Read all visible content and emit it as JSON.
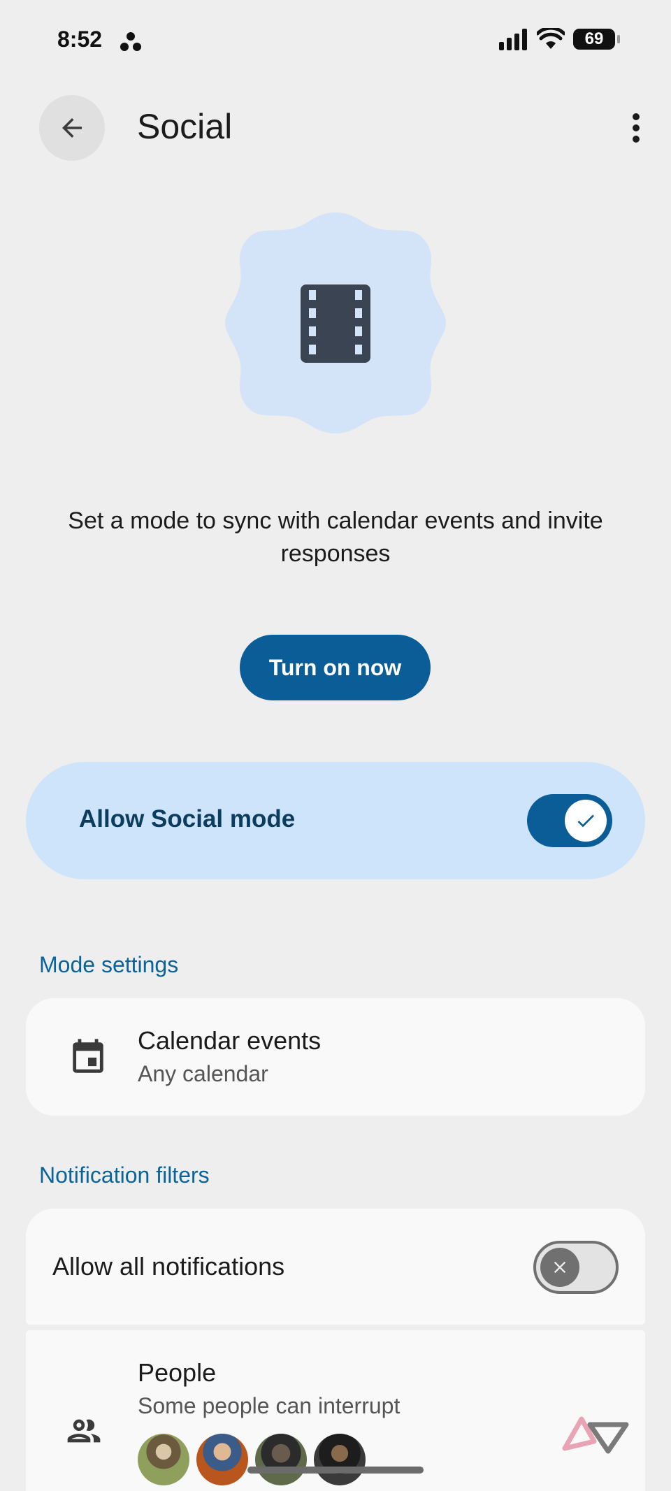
{
  "status_bar": {
    "time": "8:52",
    "battery": "69"
  },
  "header": {
    "title": "Social"
  },
  "hero": {
    "description": "Set a mode to sync with calendar events and invite responses"
  },
  "turn_on_button": {
    "label": "Turn on now"
  },
  "allow_mode": {
    "label": "Allow Social mode",
    "enabled": true
  },
  "mode_settings": {
    "heading": "Mode settings",
    "calendar": {
      "title": "Calendar events",
      "subtitle": "Any calendar"
    }
  },
  "notification_filters": {
    "heading": "Notification filters",
    "allow_all": {
      "label": "Allow all notifications",
      "enabled": false
    },
    "people": {
      "title": "People",
      "subtitle": "Some people can interrupt"
    }
  },
  "colors": {
    "accent": "#0a5d97",
    "accent_container": "#cde4fb",
    "section_label": "#0a6499",
    "hero_shape": "#d3e3f8"
  },
  "icons": [
    "back-arrow-icon",
    "more-vert-icon",
    "film-icon",
    "check-icon",
    "calendar-icon",
    "close-icon",
    "people-icon"
  ]
}
